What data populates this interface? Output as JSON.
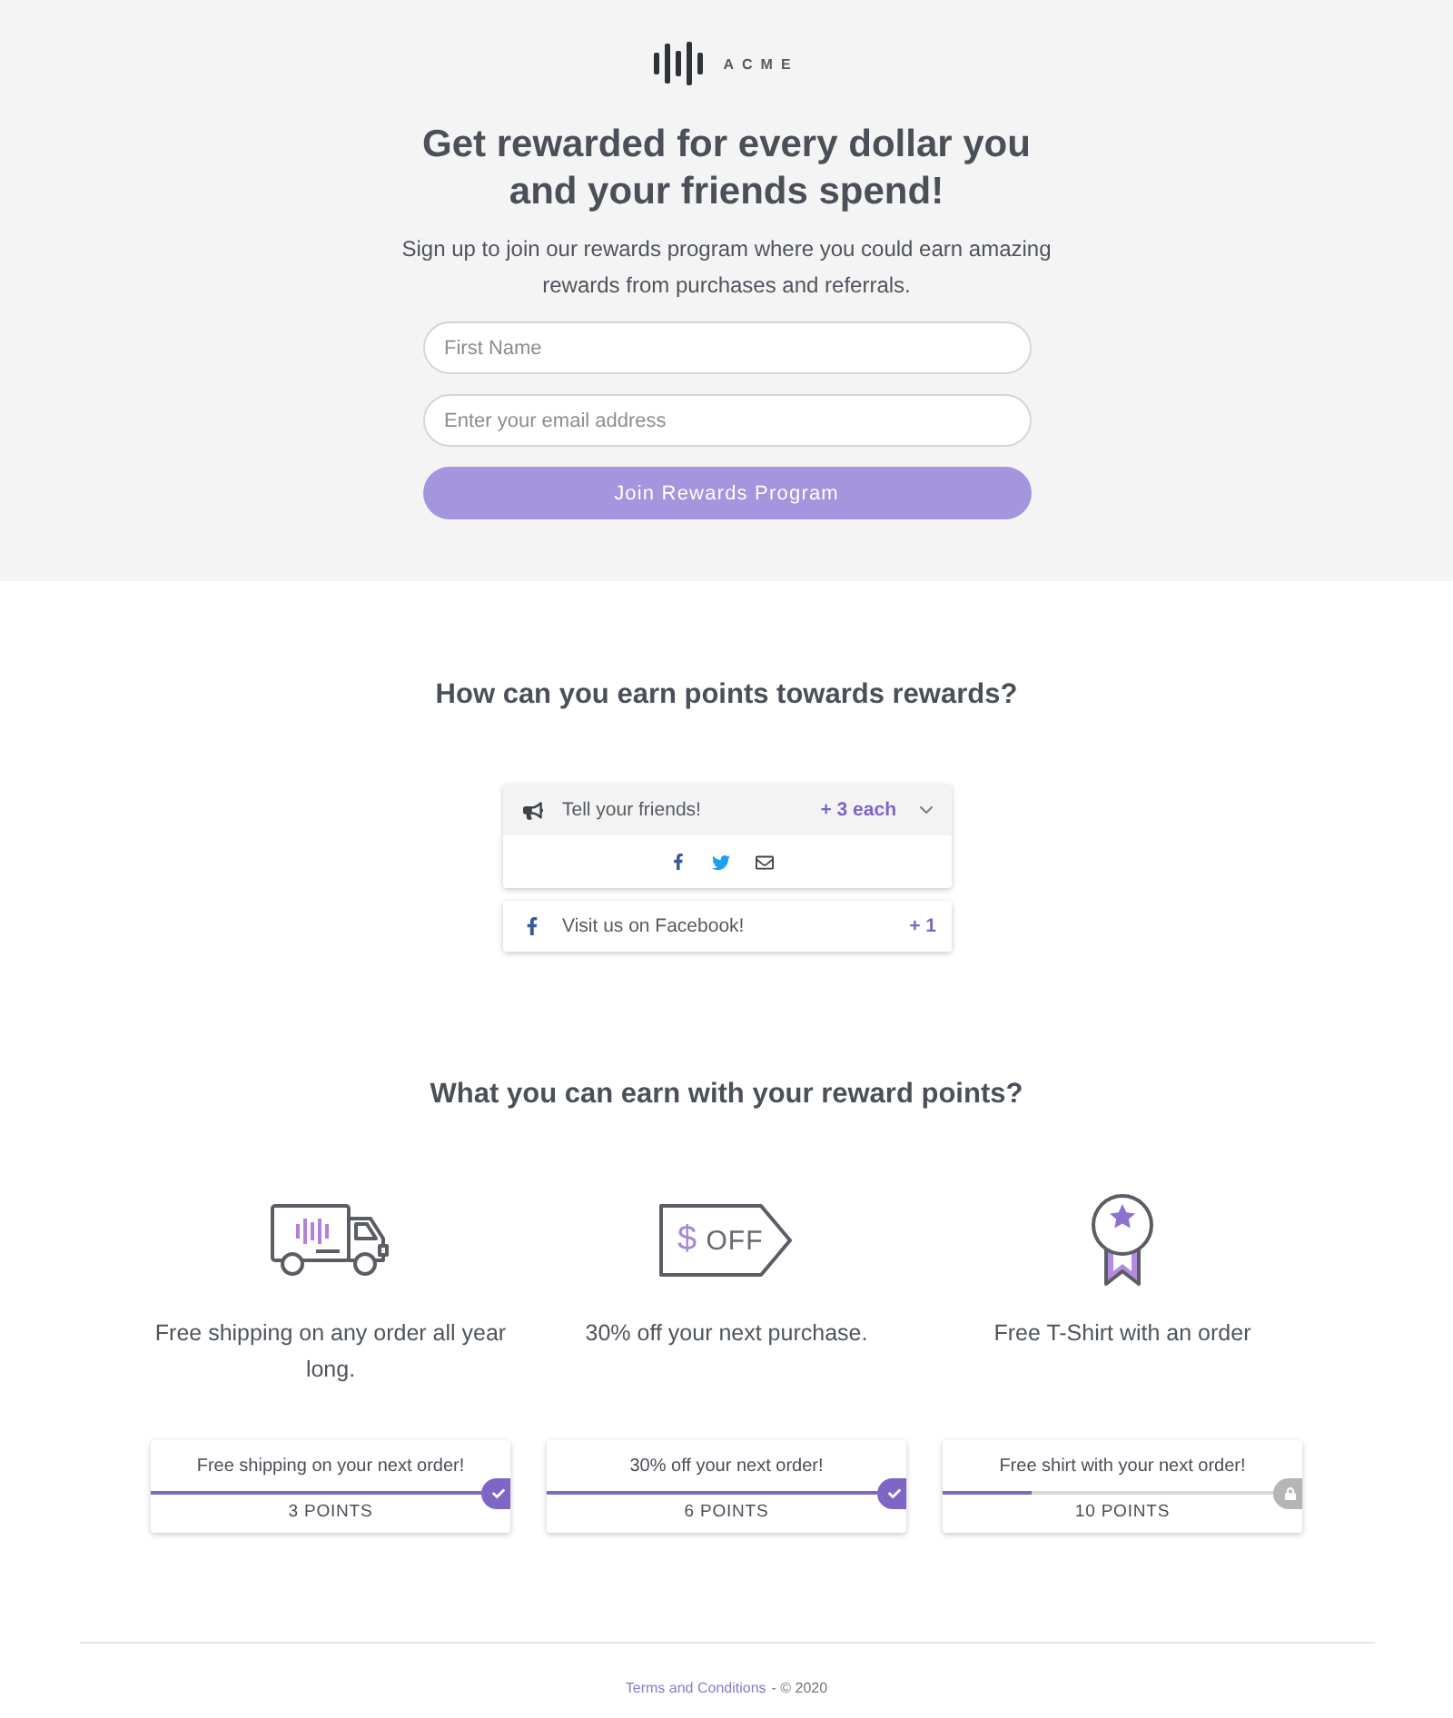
{
  "logo": {
    "name": "ACME"
  },
  "hero": {
    "title": "Get rewarded for every dollar you and your friends spend!",
    "subtitle": "Sign up to join our rewards program where you could earn amazing rewards from purchases and referrals.",
    "fields": [
      {
        "placeholder": "First Name"
      },
      {
        "placeholder": "Enter your email address"
      }
    ],
    "button": "Join Rewards Program"
  },
  "earn": {
    "heading": "How can you earn points towards rewards?",
    "actions": [
      {
        "kind": "share",
        "label": "Tell your friends!",
        "points": "+ 3 each",
        "expanded": true
      },
      {
        "kind": "follow",
        "label": "Visit us on Facebook!",
        "points": "+ 1"
      }
    ]
  },
  "rewards": {
    "heading": "What you can earn with your reward points?",
    "items": [
      {
        "kind": "truck",
        "description": "Free shipping on any order all year long.",
        "title": "Free shipping on your next order!",
        "level": 1,
        "points": "3 POINTS",
        "unlocked": true
      },
      {
        "kind": "tag",
        "tag_symbol": "$",
        "tag_text": "OFF",
        "description": "30% off your next purchase.",
        "title": "30% off your next order!",
        "level": 1,
        "points": "6 POINTS",
        "unlocked": true
      },
      {
        "kind": "medal",
        "description": "Free T-Shirt with an order",
        "title": "Free shirt with your next order!",
        "level": 0.27,
        "points": "10 POINTS",
        "unlocked": false
      }
    ]
  },
  "footer": {
    "link": "Terms and Conditions",
    "notice": "- © 2020"
  }
}
